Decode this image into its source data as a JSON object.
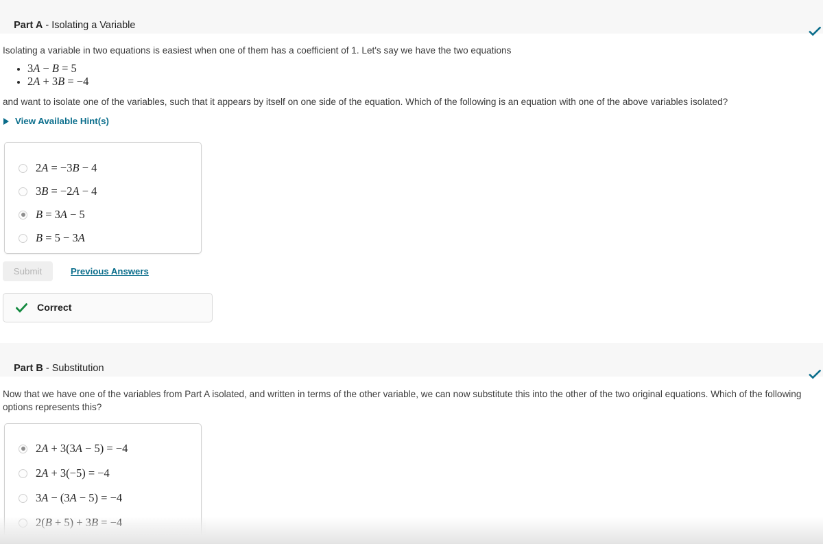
{
  "parts": [
    {
      "label": "Part A",
      "separator": " - ",
      "title": "Isolating a Variable",
      "status_icon": "check-icon",
      "status_color": "#0b6e8c",
      "intro": "Isolating a variable in two equations is easiest when one of them has a coefficient of 1. Let's say we have the two equations",
      "equations": [
        "3A − B = 5",
        "2A + 3B = −4"
      ],
      "question": "and want to isolate one of the variables, such that it appears by itself on one side of the equation. Which of the following is an equation with one of the above variables isolated?",
      "hint_label": "View Available Hint(s)",
      "hint_icon": "triangle-right-icon",
      "options": [
        {
          "text": "2A = −3B − 4",
          "selected": false
        },
        {
          "text": "3B = −2A − 4",
          "selected": false
        },
        {
          "text": "B = 3A − 5",
          "selected": true
        },
        {
          "text": "B = 5 − 3A",
          "selected": false
        }
      ],
      "submit_label": "Submit",
      "submit_disabled": true,
      "previous_answers_label": "Previous Answers",
      "feedback": {
        "icon": "check-icon",
        "label": "Correct",
        "color": "#13893f"
      }
    },
    {
      "label": "Part B",
      "separator": " - ",
      "title": "Substitution",
      "status_icon": "check-icon",
      "status_color": "#0b6e8c",
      "question": "Now that we have one of the variables from Part A isolated, and written in terms of the other variable, we can now substitute this into the other of the two original equations. Which of the following options represents this?",
      "options": [
        {
          "text": "2A + 3(3A − 5) = −4",
          "selected": true
        },
        {
          "text": "2A + 3(−5) = −4",
          "selected": false
        },
        {
          "text": "3A − (3A − 5) = −4",
          "selected": false
        },
        {
          "text": "2(B + 5) + 3B = −4",
          "selected": false
        }
      ]
    }
  ],
  "colors": {
    "band_background": "#f7f7f7",
    "link": "#0b6e8c",
    "correct_green": "#13893f",
    "text": "#333333"
  }
}
